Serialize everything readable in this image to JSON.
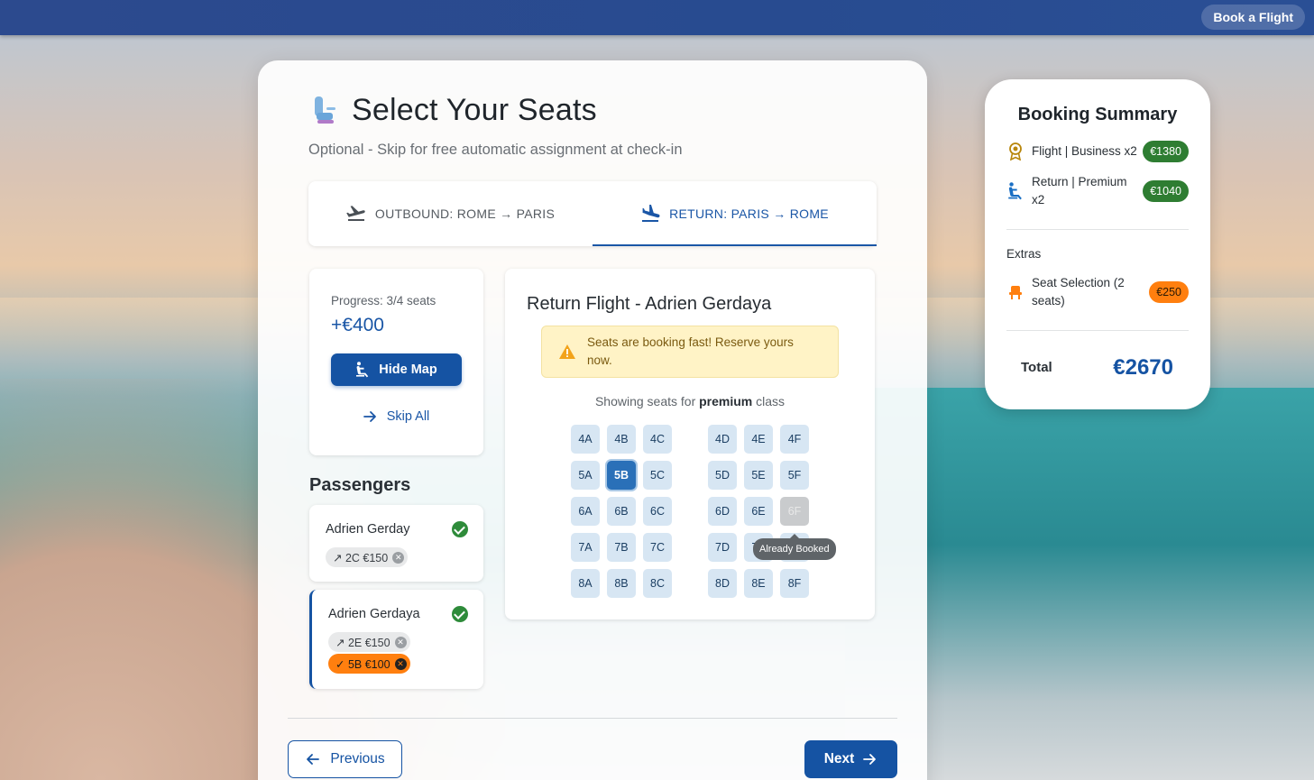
{
  "topbar": {
    "book_label": "Book a Flight"
  },
  "page": {
    "title": "Select Your Seats",
    "subtitle": "Optional - Skip for free automatic assignment at check-in"
  },
  "tabs": [
    {
      "label": "OUTBOUND: ROME → PARIS",
      "icon": "plane-takeoff-icon",
      "active": false
    },
    {
      "label": "RETURN: PARIS → ROME",
      "icon": "plane-landing-icon",
      "active": true
    }
  ],
  "progress": {
    "label": "Progress: 3/4 seats",
    "price": "+€400",
    "hide_map_label": "Hide Map",
    "skip_all_label": "Skip All"
  },
  "passengers": {
    "title": "Passengers",
    "list": [
      {
        "name": "Adrien Gerday",
        "complete": true,
        "chips": [
          {
            "text": "↗ 2C €150",
            "style": "grey"
          }
        ]
      },
      {
        "name": "Adrien Gerdaya",
        "complete": true,
        "chips": [
          {
            "text": "↗ 2E €150",
            "style": "grey"
          },
          {
            "text": "✓ 5B €100",
            "style": "orange"
          }
        ]
      }
    ]
  },
  "seat_map": {
    "title": "Return Flight - Adrien Gerdaya",
    "alert": "Seats are booking fast! Reserve yours now.",
    "class_note_prefix": "Showing seats for ",
    "class_name": "premium",
    "class_note_suffix": " class",
    "rows": [
      [
        "4A",
        "4B",
        "4C",
        "4D",
        "4E",
        "4F"
      ],
      [
        "5A",
        "5B",
        "5C",
        "5D",
        "5E",
        "5F"
      ],
      [
        "6A",
        "6B",
        "6C",
        "6D",
        "6E",
        "6F"
      ],
      [
        "7A",
        "7B",
        "7C",
        "7D",
        "7E",
        "7F"
      ],
      [
        "8A",
        "8B",
        "8C",
        "8D",
        "8E",
        "8F"
      ]
    ],
    "selected": "5B",
    "booked": "6F",
    "tooltip": "Already Booked"
  },
  "nav": {
    "previous_label": "Previous",
    "next_label": "Next"
  },
  "summary": {
    "title": "Booking Summary",
    "items": [
      {
        "label": "Flight | Business x2",
        "price": "€1380",
        "icon": "award-icon"
      },
      {
        "label": "Return | Premium x2",
        "price": "€1040",
        "icon": "seat-icon"
      }
    ],
    "extras_label": "Extras",
    "extras": [
      {
        "label": "Seat Selection (2 seats)",
        "price": "€250",
        "icon": "chair-icon"
      }
    ],
    "total_label": "Total",
    "total_value": "€2670"
  },
  "colors": {
    "primary": "#1553a3",
    "accent_orange": "#ff7f0f",
    "success_green": "#2e7d32",
    "topbar": "#2c4a8e"
  }
}
